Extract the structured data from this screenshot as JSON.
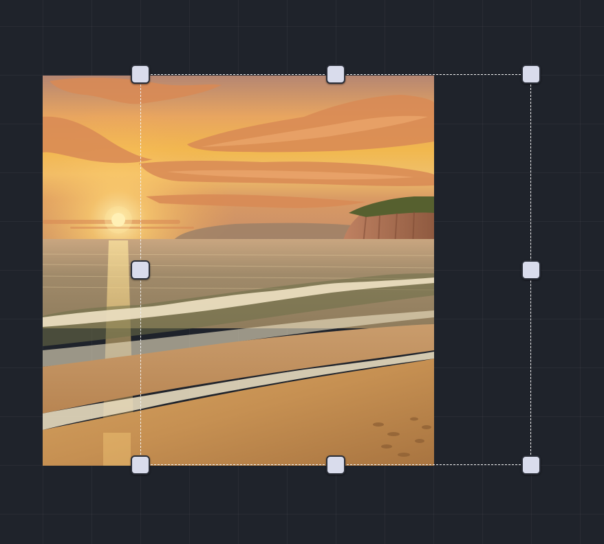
{
  "canvas": {
    "background_color": "#1f232b",
    "grid": true
  },
  "image": {
    "subject": "sunset-beach",
    "colors": {
      "sky_top": "#b07f6c",
      "sky_glow": "#f1b74c",
      "sun": "#ffe9a8",
      "sea": "#a98a63",
      "wave_foam": "#efe1c2",
      "sand": "#c48d4d",
      "cliff": "#a0684a",
      "cliff_top": "#4f5a2f"
    }
  },
  "selection": {
    "border_style": "dashed",
    "border_color": "#f2f2f2",
    "handle_color": "#d9dcec",
    "handles": [
      "nw",
      "n",
      "ne",
      "w",
      "e",
      "sw",
      "s",
      "se"
    ]
  }
}
